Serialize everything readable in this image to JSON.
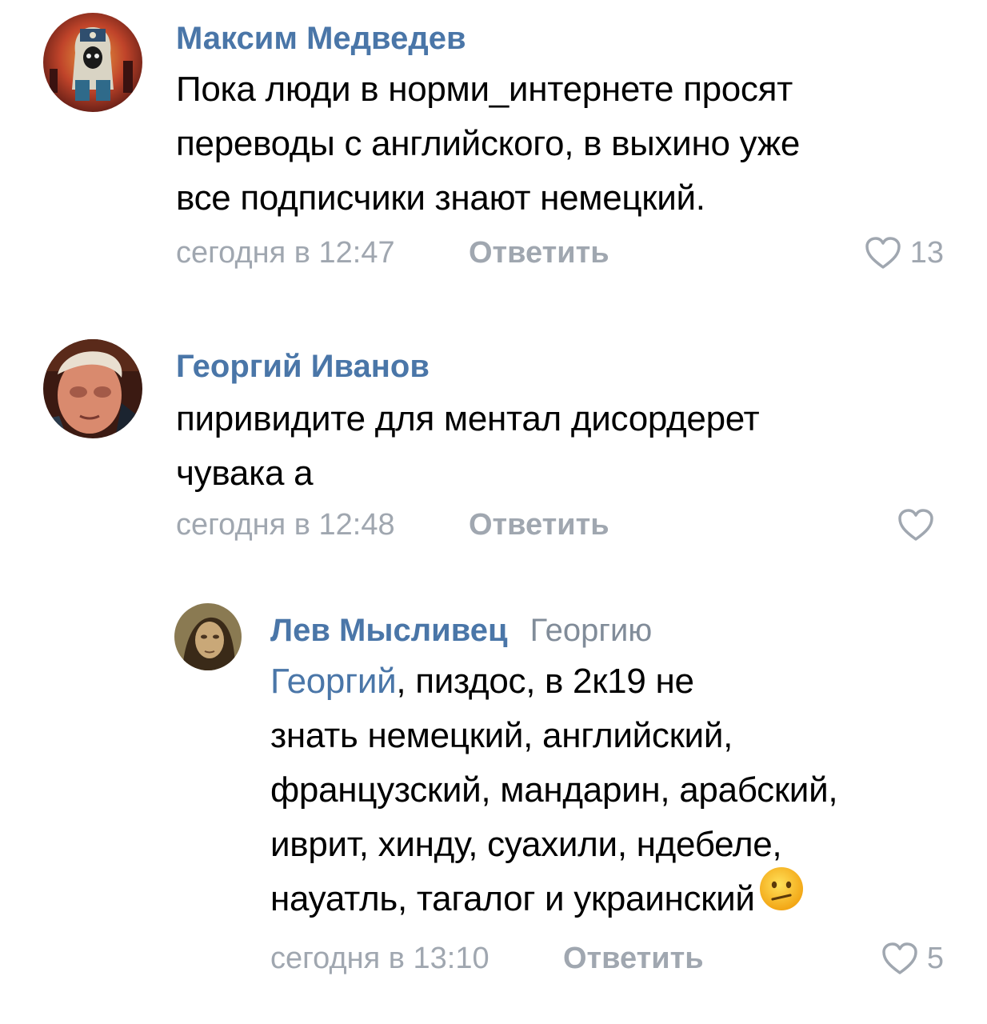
{
  "comments": [
    {
      "author": "Максим Медведев",
      "text_lines": [
        "Пока люди в норми_интернете просят",
        "переводы с английского, в выхино уже",
        "все подписчики знают немецкий."
      ],
      "time": "сегодня в 12:47",
      "reply_label": "Ответить",
      "likes": "13",
      "avatar_icon": "hooded-figure-avatar"
    },
    {
      "author": "Георгий Иванов",
      "text_lines": [
        "пиривидите для ментал дисордерет",
        "чувака а"
      ],
      "time": "сегодня в 12:48",
      "reply_label": "Ответить",
      "likes": "",
      "avatar_icon": "man-portrait-avatar"
    },
    {
      "author": "Лев Мысливец",
      "reply_to": "Георгию",
      "mention": "Георгий",
      "text_lines": [
        ", пиздос, в 2к19 не",
        "знать немецкий, английский,",
        "французский, мандарин, арабский,",
        "иврит, хинду, суахили, ндебеле,",
        "науатль, тагалог и украинский"
      ],
      "emoji": "confused-face-emoji",
      "time": "сегодня в 13:10",
      "reply_label": "Ответить",
      "likes": "5",
      "avatar_icon": "painted-portrait-avatar"
    }
  ],
  "colors": {
    "author": "#4a76a8",
    "meta": "#a0a7b0",
    "text": "#000000"
  }
}
